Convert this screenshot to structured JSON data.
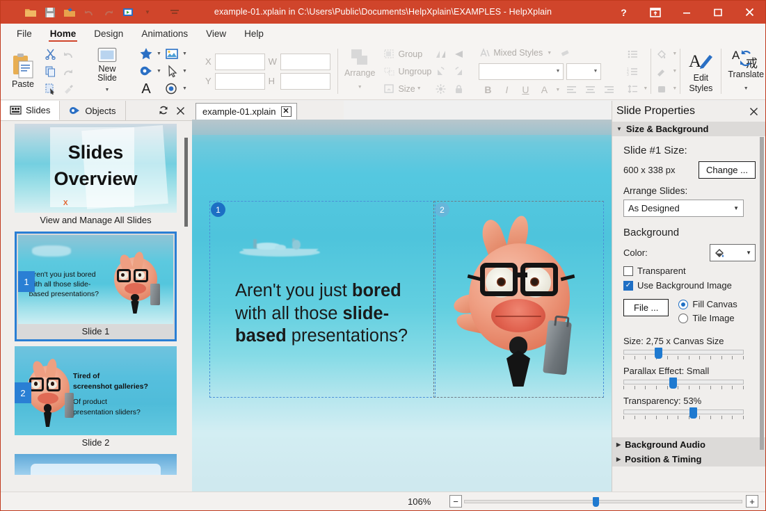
{
  "window": {
    "title": "example-01.xplain in C:\\Users\\Public\\Documents\\HelpXplain\\EXAMPLES - HelpXplain",
    "accent_color": "#d0452b",
    "help_label": "?",
    "restore_down_label": "⤓",
    "minimize_label": "–",
    "maximize_label": "☐",
    "close_label": "✕"
  },
  "quick_access": [
    {
      "name": "open-icon",
      "glyph": "📁"
    },
    {
      "name": "save-icon",
      "glyph": "💾"
    },
    {
      "name": "save-as-icon",
      "glyph": "📤"
    },
    {
      "name": "undo-icon",
      "glyph": "↶"
    },
    {
      "name": "redo-icon",
      "glyph": "↷"
    },
    {
      "name": "present-icon",
      "glyph": "▶"
    },
    {
      "name": "dropdown-caret-icon",
      "glyph": "▾"
    },
    {
      "name": "customize-qat-icon",
      "glyph": "≡"
    }
  ],
  "ribbon": {
    "tabs": [
      {
        "label": "File",
        "active": false
      },
      {
        "label": "Home",
        "active": true
      },
      {
        "label": "Design",
        "active": false
      },
      {
        "label": "Animations",
        "active": false
      },
      {
        "label": "View",
        "active": false
      },
      {
        "label": "Help",
        "active": false
      }
    ],
    "clipboard": {
      "paste_label": "Paste",
      "cut_label": "Cut",
      "copy_label": "Copy",
      "select_label": "Select",
      "undo_label": "Undo",
      "redo_label": "Redo",
      "format_painter_label": "Format Painter"
    },
    "slides": {
      "new_slide_label": "New Slide"
    },
    "insert": {
      "shape_label": "Shape",
      "image_label": "Image",
      "object_label": "Object",
      "pointer_label": "Pointer",
      "text_label": "T",
      "hotspot_label": "Hotspot"
    },
    "position": {
      "x_label": "X",
      "x_value": "",
      "y_label": "Y",
      "y_value": "",
      "w_label": "W",
      "w_value": "",
      "h_label": "H",
      "h_value": "",
      "arrange_label": "Arrange",
      "group_label": "Group",
      "ungroup_label": "Ungroup",
      "size_label": "Size"
    },
    "styles": {
      "mixed_styles_label": "Mixed Styles",
      "font_value": "",
      "font_size_value": "",
      "bold_label": "B",
      "italic_label": "I",
      "underline_label": "U",
      "font_color_label": "A",
      "edit_styles_label_1": "Edit",
      "edit_styles_label_2": "Styles",
      "translate_label": "Translate"
    }
  },
  "left_panel": {
    "tabs": [
      {
        "label": "Slides",
        "icon": "filmstrip-icon",
        "active": true
      },
      {
        "label": "Objects",
        "icon": "objects-icon",
        "active": false
      }
    ],
    "refresh_label": "↻",
    "close_label": "✕",
    "thumbnails": [
      {
        "caption": "View and Manage All Slides",
        "kind": "overview",
        "title_line1": "Slides",
        "title_line2": "Overview",
        "number": "",
        "selected": false
      },
      {
        "caption": "Slide 1",
        "kind": "slide",
        "number": "1",
        "text_line1": "Aren't you just bored",
        "text_line2": "with all those slide-",
        "text_line3": "based presentations?",
        "selected": true
      },
      {
        "caption": "Slide 2",
        "kind": "slide",
        "number": "2",
        "text_line1": "Tired of",
        "text_line2": "screenshot galleries?",
        "text_line3": "Of product",
        "text_line4": "presentation sliders?",
        "selected": false
      }
    ]
  },
  "document_tab": {
    "label": "example-01.xplain",
    "close_label": "✕"
  },
  "canvas": {
    "slide_text_a": "Aren't you just ",
    "slide_text_a_bold": "bored",
    "slide_text_b": "with all those ",
    "slide_text_b_bold": "slide-",
    "slide_text_c_bold": "based",
    "slide_text_c": " presentations?",
    "object_badge_1": "1",
    "object_badge_2": "2"
  },
  "right_panel": {
    "title": "Slide Properties",
    "close_label": "✕",
    "sections": [
      {
        "label": "Size & Background",
        "expanded": true
      },
      {
        "label": "Background Audio",
        "expanded": false
      },
      {
        "label": "Position & Timing",
        "expanded": false
      }
    ],
    "slide_size_heading": "Slide #1 Size:",
    "slide_size_value": "600 x 338 px",
    "change_button": "Change ...",
    "arrange_slides_label": "Arrange Slides:",
    "arrange_slides_value": "As Designed",
    "background_heading": "Background",
    "color_label": "Color:",
    "transparent_label": "Transparent",
    "transparent_checked": false,
    "use_background_image_label": "Use Background Image",
    "use_background_image_checked": true,
    "file_button": "File ...",
    "fill_canvas_label": "Fill Canvas",
    "fill_canvas_selected": true,
    "tile_image_label": "Tile Image",
    "tile_image_selected": false,
    "size_slider_label": "Size: 2,75 x Canvas Size",
    "size_slider_pct": 27,
    "parallax_slider_label": "Parallax Effect: Small",
    "parallax_slider_pct": 40,
    "transparency_slider_label": "Transparency: 53%",
    "transparency_slider_pct": 58
  },
  "status_bar": {
    "zoom_label": "106%",
    "zoom_out_label": "−",
    "zoom_in_label": "+",
    "zoom_slider_pct": 47
  }
}
